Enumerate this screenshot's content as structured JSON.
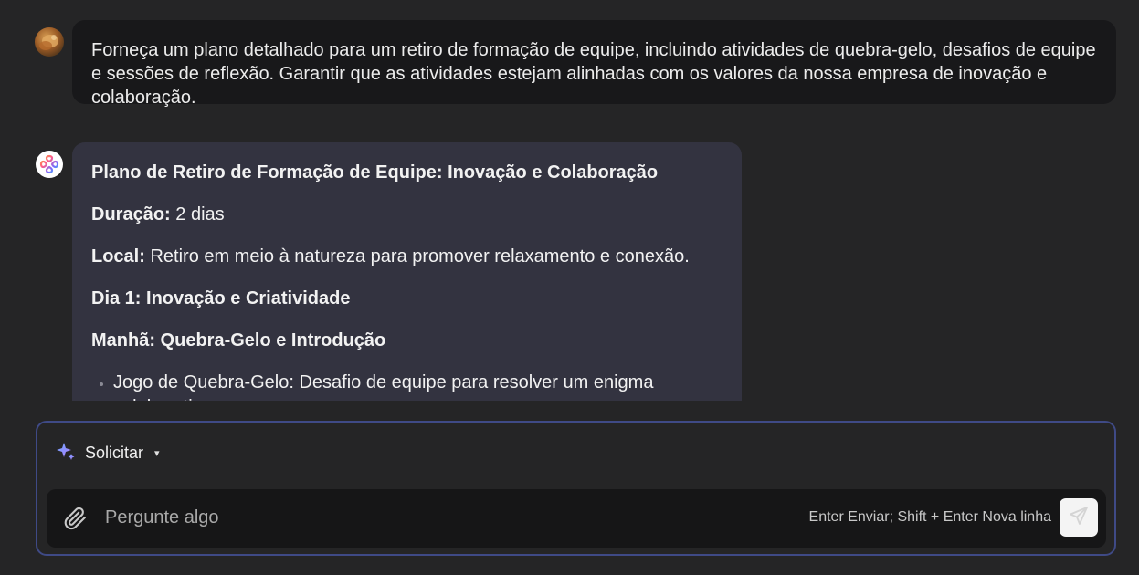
{
  "user_message": {
    "avatar": "user-avatar",
    "text": "Forneça um plano detalhado para um retiro de formação de equipe, incluindo atividades de quebra-gelo, desafios de equipe e sessões de reflexão. Garantir que as atividades estejam alinhadas com os valores da nossa empresa de inovação e colaboração."
  },
  "bot_message": {
    "avatar": "assistant-logo-icon",
    "title": "Plano de Retiro de Formação de Equipe: Inovação e Colaboração",
    "duration_label": "Duração:",
    "duration_value": " 2 dias",
    "location_label": "Local:",
    "location_value": " Retiro em meio à natureza para promover relaxamento e conexão.",
    "day1_heading": "Dia 1: Inovação e Criatividade",
    "morning_heading": "Manhã: Quebra-Gelo e Introdução",
    "bullets": [
      "Jogo de Quebra-Gelo: Desafio de equipe para resolver um enigma colaborativo."
    ]
  },
  "composer": {
    "mode_icon": "sparkle-icon",
    "mode_label": "Solicitar",
    "mode_caret": "▾",
    "placeholder": "Pergunte algo",
    "value": "",
    "hint": "Enter Enviar; Shift + Enter Nova linha",
    "attach_icon": "paperclip-icon",
    "send_icon": "send-icon",
    "accent_color": "#3f4a86"
  }
}
